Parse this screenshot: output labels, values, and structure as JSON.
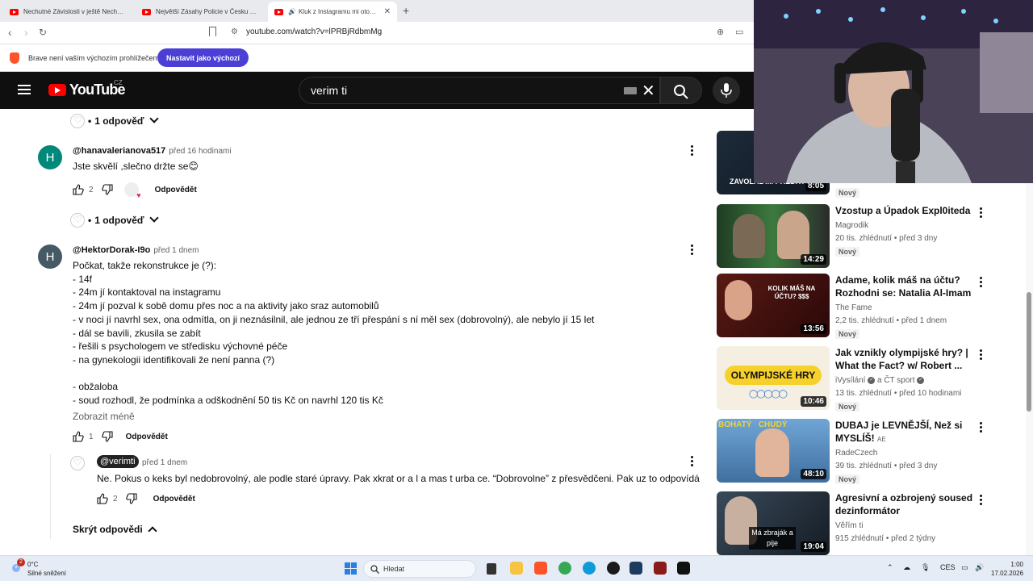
{
  "browser": {
    "tabs": [
      {
        "title": "Nechutné Závislosti v ještě Nechutnější",
        "active": false
      },
      {
        "title": "Největší Zásahy Policie v Česku - You",
        "active": false
      },
      {
        "title": "Kluk z Instagramu mi otočil ži",
        "active": true
      }
    ],
    "url": "youtube.com/watch?v=lPRBjRdbmMg",
    "infobar": {
      "text": "Brave není vaším výchozím prohlížečem",
      "button": "Nastavit jako výchozí"
    }
  },
  "youtube": {
    "logo_text": "YouTube",
    "country": "CZ",
    "search_value": "verim ti"
  },
  "comments": {
    "fold1": {
      "label": "1 odpověď"
    },
    "c1": {
      "avatar_letter": "H",
      "avatar_color": "#00897b",
      "author": "@hanavalerianova517",
      "when": "před 16 hodinami",
      "text": "Jste skvělí ,slečno držte se😊",
      "likes": "2",
      "reply": "Odpovědět"
    },
    "fold2": {
      "label": "1 odpověď"
    },
    "c2": {
      "avatar_letter": "H",
      "avatar_color": "#455a64",
      "author": "@HektorDorak-I9o",
      "when": "před 1 dnem",
      "lines": [
        "Počkat, takže rekonstrukce je (?):",
        "- 14f",
        "- 24m jí kontaktoval na instagramu",
        "- 24m jí pozval k sobě domu přes noc a na aktivity jako sraz automobilů",
        "- v noci jí navrhl sex, ona odmítla, on ji neznásilnil, ale jednou ze tří přespání s ní měl sex (dobrovolný), ale nebylo jí 15 let",
        "- dál se bavili, zkusila se zabít",
        "- řešili s psychologem ve středisku výchovné péče",
        "- na gynekologii identifikovali že není panna (?)",
        "",
        "- obžaloba",
        "- soud rozhodl, že podmínka a odškodnění 50 tis Kč on navrhl 120 tis Kč"
      ],
      "show_less": "Zobrazit méně",
      "likes": "1",
      "reply": "Odpovědět"
    },
    "r1": {
      "author": "@verimti",
      "when": "před 1 dnem",
      "text": "Ne. Pokus o keks byl nedobrovolný, ale podle staré úpravy. Pak xkrat or a l a mas t urba ce. “Dobrovolne” z přesvědčeni. Pak uz to odpovídá",
      "likes": "2",
      "reply": "Odpovědět"
    },
    "hide_replies": "Skrýt odpovědi"
  },
  "sidebar": [
    {
      "title": "",
      "channel": "",
      "meta": "",
      "badge": "Nový",
      "duration": "8:05",
      "thumb_color": "#1d2b3a",
      "thumb_text": "ZAVOLAL MI PREDÁTOR?!"
    },
    {
      "title": "Vzostup a Úpadok Expl0iteda",
      "channel": "Magrodik",
      "meta": "20 tis. zhlédnutí • před 3 dny",
      "badge": "Nový",
      "duration": "14:29",
      "thumb_color": "#2b4a2e",
      "thumb_text": ""
    },
    {
      "title": "Adame, kolik máš na účtu? Rozhodni se: Natalia Al-Imam ...",
      "channel": "The Fame",
      "meta": "2,2 tis. zhlédnutí • před 1 dnem",
      "badge": "Nový",
      "duration": "13:56",
      "thumb_color": "#4a1a1a",
      "thumb_text": "KOLIK MÁŠ NA ÚČTU? $$$"
    },
    {
      "title": "Jak vznikly olympijské hry? | What the Fact? w/ Robert ...",
      "channel": "iVysílání",
      "channel2": "a ČT sport",
      "meta": "13 tis. zhlédnutí • před 10 hodinami",
      "badge": "Nový",
      "duration": "10:46",
      "thumb_color": "#f4efe0",
      "thumb_text": "OLYMPIJSKÉ HRY"
    },
    {
      "title": "DUBAJ je LEVNĚJŠÍ, Než si MYSLÍŠ!",
      "title_suffix": "AE",
      "channel": "RadeCzech",
      "meta": "39 tis. zhlédnutí • před 3 dny",
      "badge": "Nový",
      "duration": "48:10",
      "thumb_color": "#5a8fc0",
      "thumb_text": "BOHATÝ   CHUDÝ"
    },
    {
      "title": "Agresivní a ozbrojený soused dezinformátor",
      "channel": "Věřím ti",
      "meta": "915 zhlédnutí • před 2 týdny",
      "badge": "",
      "duration": "19:04",
      "thumb_color": "#2a3a4a",
      "thumb_text": "Má zbraják a pije"
    }
  ],
  "taskbar": {
    "temp": "0°C",
    "weather": "Silné sněžení",
    "weather_badge": "2",
    "search": "Hledat",
    "lang": "CES",
    "time": "1:00",
    "date": "17.02.2026"
  }
}
